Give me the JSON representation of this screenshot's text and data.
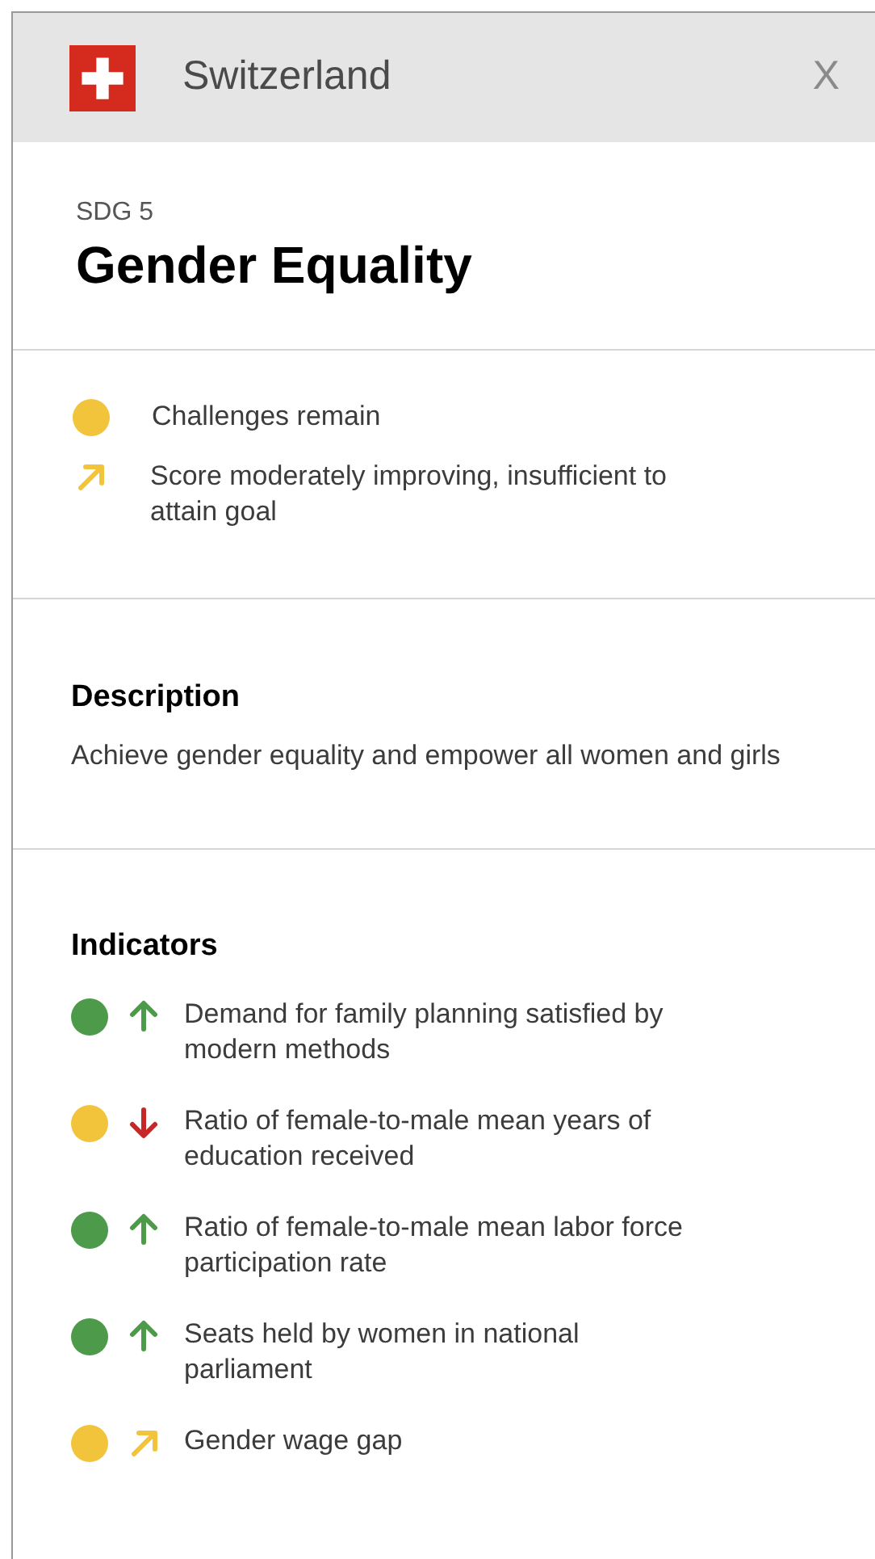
{
  "header": {
    "country": "Switzerland",
    "close": "X"
  },
  "goal": {
    "label": "SDG 5",
    "title": "Gender Equality"
  },
  "status": [
    {
      "kind": "dot",
      "color": "#f2c43c",
      "text": "Challenges remain"
    },
    {
      "kind": "moderate",
      "color": "#f2c43c",
      "text": "Score moderately improving, insufficient to attain goal"
    }
  ],
  "description": {
    "heading": "Description",
    "text": "Achieve gender equality and empower all women and girls"
  },
  "indicators": {
    "heading": "Indicators",
    "items": [
      {
        "color": "#4d9a4a",
        "kind": "up",
        "text": "Demand for family planning satisfied by modern methods"
      },
      {
        "color": "#f2c43c",
        "kind": "down",
        "text": "Ratio of female-to-male mean years of education received"
      },
      {
        "color": "#4d9a4a",
        "kind": "up",
        "text": "Ratio of female-to-male mean labor force participation rate"
      },
      {
        "color": "#4d9a4a",
        "kind": "up",
        "text": "Seats held by women in national parliament"
      },
      {
        "color": "#f2c43c",
        "kind": "moderate",
        "text": "Gender wage gap"
      }
    ]
  }
}
